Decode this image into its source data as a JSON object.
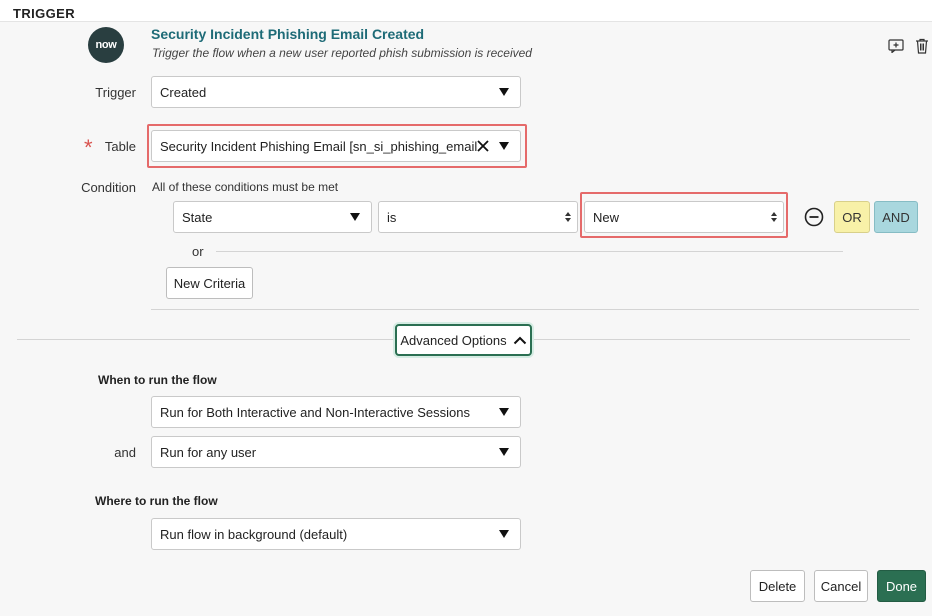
{
  "header": {
    "section_title": "TRIGGER"
  },
  "trigger": {
    "logo_text": "now",
    "title": "Security Incident Phishing Email Created",
    "description": "Trigger the flow when a new user reported phish submission is received"
  },
  "fields": {
    "trigger_label": "Trigger",
    "trigger_value": "Created",
    "required_mark": "*",
    "table_label": "Table",
    "table_value": "Security Incident Phishing Email [sn_si_phishing_email]",
    "condition_label": "Condition",
    "condition_help": "All of these conditions must be met"
  },
  "condition_row": {
    "field": "State",
    "operator": "is",
    "value": "New",
    "or_label": "OR",
    "and_label": "AND",
    "or_separator": "or",
    "new_criteria_label": "New Criteria"
  },
  "advanced": {
    "toggle_label": "Advanced Options",
    "when_heading": "When to run the flow",
    "sessions_value": "Run for Both Interactive and Non-Interactive Sessions",
    "and_label": "and",
    "user_value": "Run for any user",
    "where_heading": "Where to run the flow",
    "where_value": "Run flow in background (default)"
  },
  "footer": {
    "delete_label": "Delete",
    "cancel_label": "Cancel",
    "done_label": "Done"
  },
  "colors": {
    "title": "#1e6b77",
    "highlight": "#e56a6a",
    "done": "#2b6f52",
    "or_button": "#f8f1a8",
    "and_button": "#a9d7de"
  },
  "icons": [
    "add-note-icon",
    "trash-icon",
    "clear-icon",
    "minus-circle-icon",
    "chevron-up-icon"
  ]
}
